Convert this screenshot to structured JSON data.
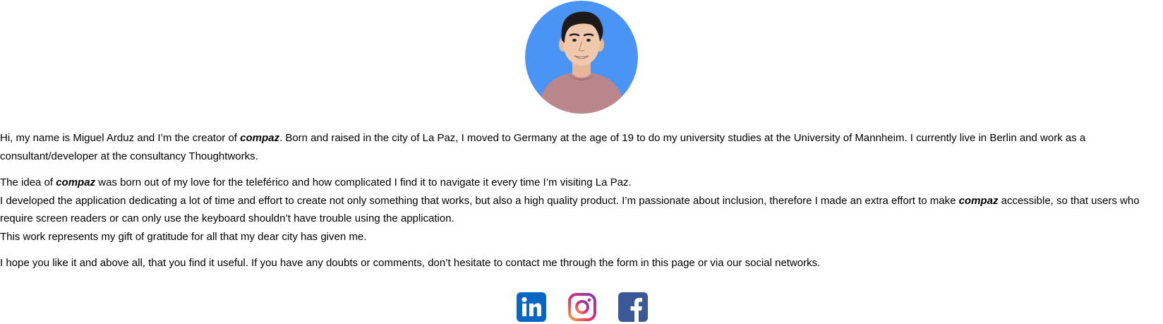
{
  "about": {
    "avatar_alt": "Miguel Arduz portrait",
    "intro": {
      "before": "Hi, my name is Miguel Arduz and I’m the creator of ",
      "brand": "compaz",
      "after": ". Born and raised in the city of La Paz, I moved to Germany at the age of 19 to do my university studies at the University of Mannheim. I currently live in Berlin and work as a consultant/developer at the consultancy Thoughtworks."
    },
    "idea": {
      "before": "The idea of ",
      "brand": "compaz",
      "after": " was born out of my love for the teleférico and how complicated I find it to navigate it every time I’m visiting La Paz."
    },
    "development": {
      "before": "I developed the application dedicating a lot of time and effort to create not only something that works, but also a high quality product. I’m passionate about inclusion, therefore I made an extra effort to make ",
      "brand": "compaz",
      "after": " accessible, so that users who require screen readers or can only use the keyboard shouldn’t have trouble using the application."
    },
    "gratitude": "This work represents my gift of gratitude for all that my dear city has given me.",
    "closing": "I hope you like it and above all, that you find it useful. If you have any doubts or comments, don’t hesitate to contact me through the form in this page or via our social networks."
  },
  "social": {
    "items": [
      {
        "name": "LinkedIn",
        "icon": "linkedin-icon",
        "color": "#0A66C2"
      },
      {
        "name": "Instagram",
        "icon": "instagram-icon",
        "color": "#C13584"
      },
      {
        "name": "Facebook",
        "icon": "facebook-icon",
        "color": "#3B5998"
      }
    ]
  },
  "colors": {
    "avatar_bg": "#4A94F5",
    "shirt": "#B9868B"
  }
}
